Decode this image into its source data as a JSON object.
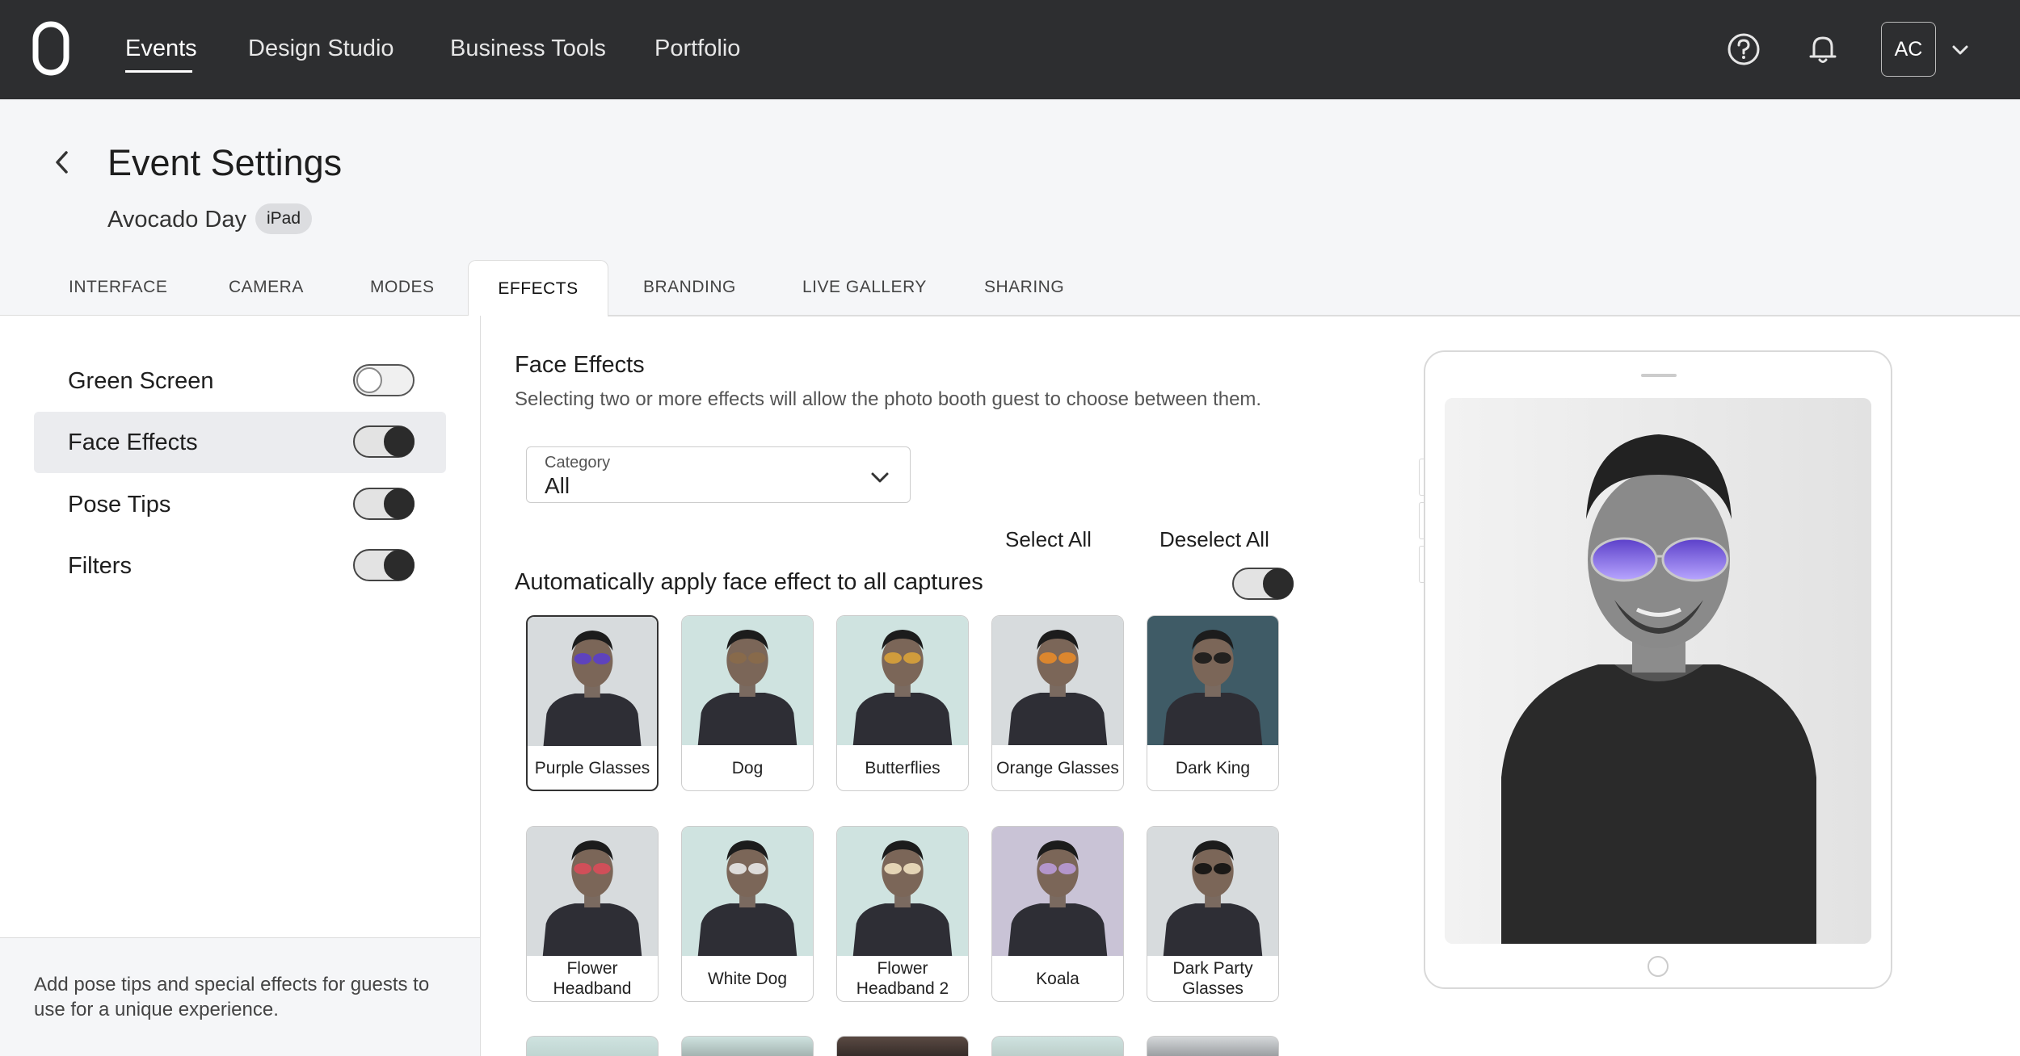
{
  "nav": {
    "items": [
      "Events",
      "Design Studio",
      "Business Tools",
      "Portfolio"
    ],
    "avatar_initials": "AC"
  },
  "header": {
    "title": "Event Settings",
    "event_name": "Avocado Day",
    "device_badge": "iPad"
  },
  "tabs": [
    "INTERFACE",
    "CAMERA",
    "MODES",
    "EFFECTS",
    "BRANDING",
    "LIVE GALLERY",
    "SHARING"
  ],
  "active_tab": "EFFECTS",
  "sidebar": {
    "items": [
      {
        "label": "Green Screen",
        "enabled": false
      },
      {
        "label": "Face Effects",
        "enabled": true,
        "selected": true
      },
      {
        "label": "Pose Tips",
        "enabled": true
      },
      {
        "label": "Filters",
        "enabled": true
      }
    ],
    "footer": "Add pose tips and special effects for guests to use for a unique experience."
  },
  "main": {
    "title": "Face Effects",
    "description": "Selecting two or more effects will allow the photo booth guest to choose between them.",
    "category_label": "Category",
    "category_value": "All",
    "select_all": "Select All",
    "deselect_all": "Deselect All",
    "auto_apply_label": "Automatically apply face effect to all captures",
    "auto_apply": true,
    "effects": [
      {
        "label": "Purple Glasses",
        "selected": true
      },
      {
        "label": "Dog"
      },
      {
        "label": "Butterflies"
      },
      {
        "label": "Orange Glasses"
      },
      {
        "label": "Dark King"
      },
      {
        "label": "Flower Headband"
      },
      {
        "label": "White Dog"
      },
      {
        "label": "Flower Headband 2"
      },
      {
        "label": "Koala"
      },
      {
        "label": "Dark Party Glasses"
      }
    ]
  },
  "colors": {
    "nav_bg": "#2d2e30",
    "header_bg": "#f5f6f8",
    "toggle_on": "#2b2b2b"
  }
}
